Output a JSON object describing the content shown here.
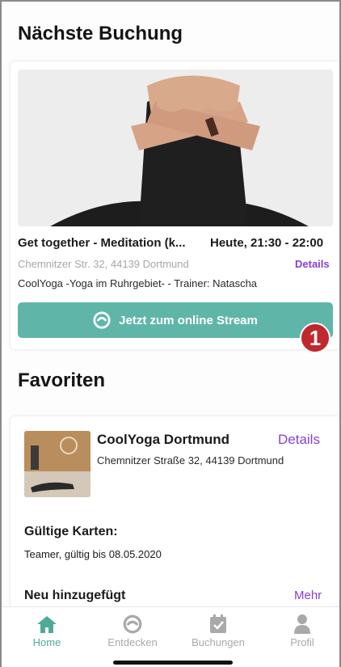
{
  "next_booking": {
    "section_title": "Nächste Buchung",
    "title": "Get together - Meditation (k...",
    "time": "Heute, 21:30 - 22:00",
    "address": "Chemnitzer Str. 32, 44139 Dortmund",
    "details_label": "Details",
    "provider_trainer": "CoolYoga -Yoga im Ruhrgebiet- - Trainer: Natascha",
    "stream_button_label": "Jetzt zum online Stream",
    "annotation_badge": "1"
  },
  "favorites": {
    "section_title": "Favoriten",
    "studio_name": "CoolYoga Dortmund",
    "details_label": "Details",
    "studio_address": "Chemnitzer Straße 32, 44139 Dortmund",
    "valid_cards_title": "Gültige Karten:",
    "valid_card_text": "Teamer, gültig bis 08.05.2020",
    "new_added_title": "Neu hinzugefügt",
    "more_label": "Mehr"
  },
  "tabbar": {
    "items": [
      {
        "label": "Home",
        "icon": "home-icon",
        "active": true
      },
      {
        "label": "Entdecken",
        "icon": "discover-icon",
        "active": false
      },
      {
        "label": "Buchungen",
        "icon": "bookings-icon",
        "active": false
      },
      {
        "label": "Profil",
        "icon": "profile-icon",
        "active": false
      }
    ]
  },
  "colors": {
    "accent": "#5fb6a8",
    "tab_active": "#4fa99a",
    "link": "#8a3fd1",
    "badge": "#c0282e"
  }
}
